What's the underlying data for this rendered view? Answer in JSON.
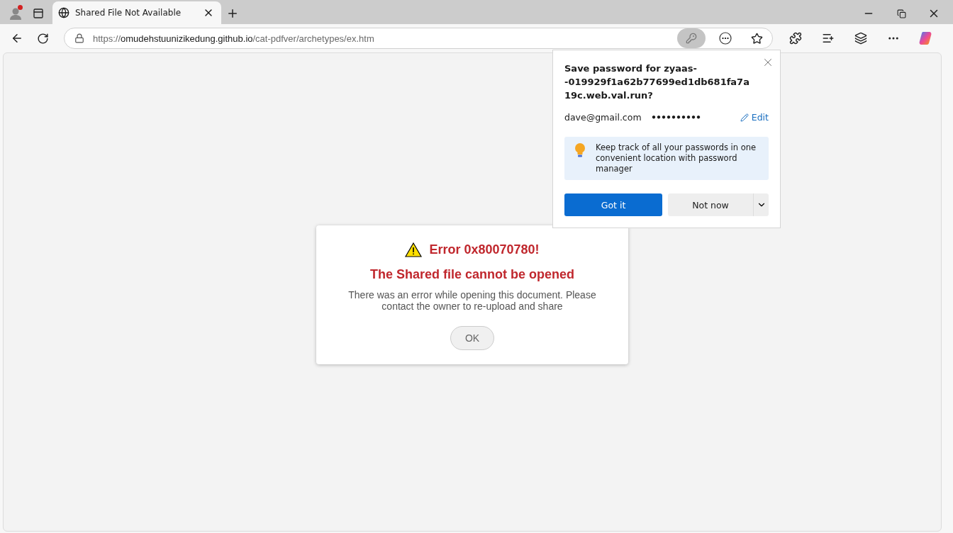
{
  "tabs": [
    {
      "title": "Shared File Not Available",
      "selected": true
    }
  ],
  "address_bar": {
    "scheme": "https://",
    "host": "omudehstuunizikedung.github.io",
    "path": "/cat-pdfver/archetypes/ex.htm",
    "password_key_active": true
  },
  "profile": {
    "notification": true
  },
  "password_popup": {
    "title": "Save password for zyaas--019929f1a62b77699ed1db681fa7a19c.web.val.run?",
    "username": "dave@gmail.com",
    "password": "••••••••••",
    "edit": "Edit",
    "tip": "Keep track of all your passwords in one convenient location with password manager",
    "primary": "Got it",
    "secondary": "Not now"
  },
  "dialog": {
    "code": "Error 0x80070780!",
    "heading": "The Shared file cannot be opened",
    "message": "There was an error while opening this document. Please contact the owner to re-upload and share",
    "button": "OK"
  }
}
